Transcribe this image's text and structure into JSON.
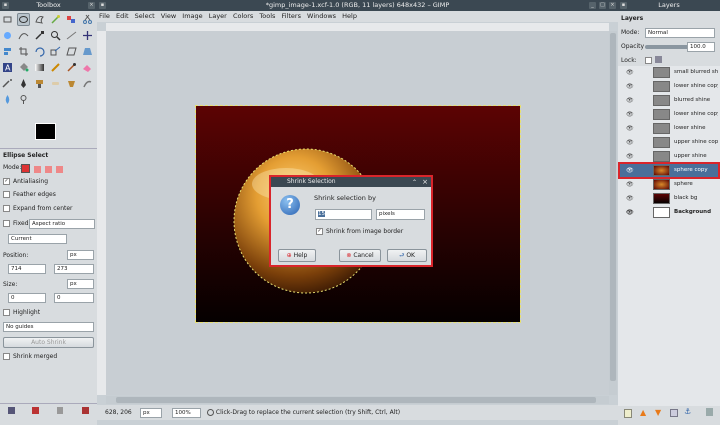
{
  "toolbox": {
    "title": "Toolbox",
    "tool_options_title": "Ellipse Select",
    "mode_label": "Mode:",
    "antialiasing_label": "Antialiasing",
    "feather_label": "Feather edges",
    "expand_label": "Expand from center",
    "fixed_label": "Fixed",
    "fixed_value": "Aspect ratio",
    "current_value": "Current",
    "position_label": "Position:",
    "position_unit": "px",
    "position_x": "714",
    "position_y": "273",
    "size_label": "Size:",
    "size_unit": "px",
    "size_w": "0",
    "size_h": "0",
    "highlight_label": "Highlight",
    "guides_value": "No guides",
    "auto_shrink_label": "Auto Shrink",
    "shrink_merged_label": "Shrink merged"
  },
  "image_window": {
    "title": "*gimp_image-1.xcf-1.0 (RGB, 11 layers) 648x432 – GIMP",
    "menu": [
      "File",
      "Edit",
      "Select",
      "View",
      "Image",
      "Layer",
      "Colors",
      "Tools",
      "Filters",
      "Windows",
      "Help"
    ],
    "status": {
      "coords": "628, 206",
      "unit": "px",
      "zoom": "100%",
      "message": "Click-Drag to replace the current selection (try Shift, Ctrl, Alt)"
    }
  },
  "layers_panel": {
    "title": "Layers",
    "tab_label": "Layers",
    "mode_label": "Mode:",
    "mode_value": "Normal",
    "opacity_label": "Opacity",
    "opacity_value": "100.0",
    "lock_label": "Lock:",
    "layers": [
      {
        "name": "small blurred shine"
      },
      {
        "name": "lower shine copy"
      },
      {
        "name": "blurred shine"
      },
      {
        "name": "lower shine copy"
      },
      {
        "name": "lower shine"
      },
      {
        "name": "upper shine copy"
      },
      {
        "name": "upper shine"
      },
      {
        "name": "sphere copy"
      },
      {
        "name": "sphere"
      },
      {
        "name": "black bg"
      },
      {
        "name": "Background"
      }
    ]
  },
  "dialog": {
    "title": "Shrink Selection",
    "prompt": "Shrink selection by",
    "amount": "15",
    "unit": "pixels",
    "border_label": "Shrink from image border",
    "help_label": "Help",
    "cancel_label": "Cancel",
    "ok_label": "OK"
  },
  "colors": {
    "title_bar": "#3b4852",
    "highlight": "#d9252b",
    "canvas_top": "#5c0303",
    "canvas_bottom": "#050000"
  }
}
